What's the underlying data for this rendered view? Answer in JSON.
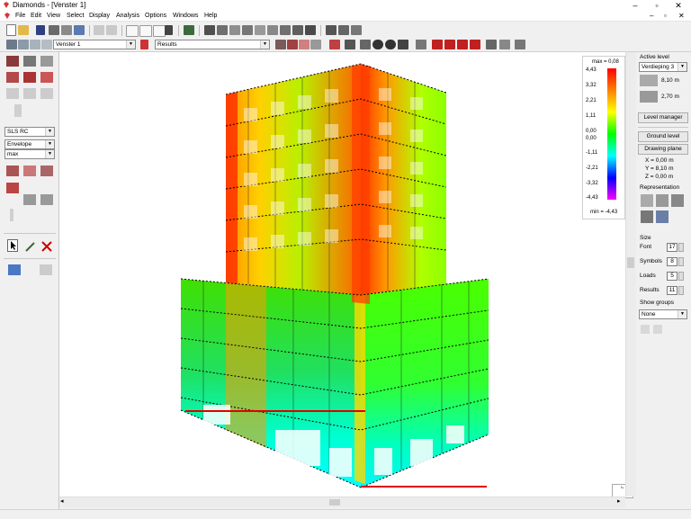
{
  "window": {
    "title": "Diamonds - [Venster 1]",
    "controls": [
      "–",
      "▫",
      "✕"
    ],
    "doc_controls": [
      "–",
      "▫",
      "✕"
    ]
  },
  "menu": [
    "File",
    "Edit",
    "View",
    "Select",
    "Display",
    "Analysis",
    "Options",
    "Windows",
    "Help"
  ],
  "toolbar2": {
    "window_select": "Venster 1",
    "results_select": "Results"
  },
  "left_panel": {
    "combination": "SLS RC",
    "mode": "Envelope",
    "extreme": "max"
  },
  "legend": {
    "max_label": "max = 0,08",
    "min_label": "min = -4,43",
    "ticks": [
      "4,43",
      "3,32",
      "2,21",
      "1,11",
      "0,00",
      "0,00",
      "-1,11",
      "-2,21",
      "-3,32",
      "-4,43"
    ],
    "colors": [
      "#ff0000",
      "#ff8000",
      "#ffff00",
      "#00ff00",
      "#00ffff",
      "#0000ff",
      "#ff00ff"
    ]
  },
  "right_panel": {
    "active_level_label": "Active level",
    "active_level_value": "Verdieping 3",
    "level_height": "8,10 m",
    "level_thickness": "2,70 m",
    "level_manager_button": "Level manager",
    "ground_level_button": "Ground level",
    "drawing_plane_button": "Drawing plane",
    "x": "X = 0,00 m",
    "y": "Y = 8,10 m",
    "z": "Z = 0,00 m",
    "representation_label": "Representation",
    "size_label": "Size",
    "font_label": "Font",
    "font_value": "17",
    "symbols_label": "Symbols",
    "symbols_value": "8",
    "loads_label": "Loads",
    "loads_value": "5",
    "results_label": "Results",
    "results_value": "11",
    "show_groups_label": "Show groups",
    "show_groups_value": "None"
  }
}
